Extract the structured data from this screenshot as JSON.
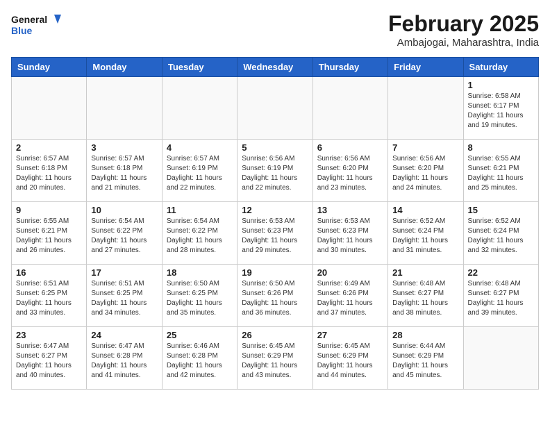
{
  "logo": {
    "line1": "General",
    "line2": "Blue"
  },
  "title": "February 2025",
  "subtitle": "Ambajogai, Maharashtra, India",
  "days_of_week": [
    "Sunday",
    "Monday",
    "Tuesday",
    "Wednesday",
    "Thursday",
    "Friday",
    "Saturday"
  ],
  "weeks": [
    [
      {
        "day": "",
        "info": ""
      },
      {
        "day": "",
        "info": ""
      },
      {
        "day": "",
        "info": ""
      },
      {
        "day": "",
        "info": ""
      },
      {
        "day": "",
        "info": ""
      },
      {
        "day": "",
        "info": ""
      },
      {
        "day": "1",
        "info": "Sunrise: 6:58 AM\nSunset: 6:17 PM\nDaylight: 11 hours\nand 19 minutes."
      }
    ],
    [
      {
        "day": "2",
        "info": "Sunrise: 6:57 AM\nSunset: 6:18 PM\nDaylight: 11 hours\nand 20 minutes."
      },
      {
        "day": "3",
        "info": "Sunrise: 6:57 AM\nSunset: 6:18 PM\nDaylight: 11 hours\nand 21 minutes."
      },
      {
        "day": "4",
        "info": "Sunrise: 6:57 AM\nSunset: 6:19 PM\nDaylight: 11 hours\nand 22 minutes."
      },
      {
        "day": "5",
        "info": "Sunrise: 6:56 AM\nSunset: 6:19 PM\nDaylight: 11 hours\nand 22 minutes."
      },
      {
        "day": "6",
        "info": "Sunrise: 6:56 AM\nSunset: 6:20 PM\nDaylight: 11 hours\nand 23 minutes."
      },
      {
        "day": "7",
        "info": "Sunrise: 6:56 AM\nSunset: 6:20 PM\nDaylight: 11 hours\nand 24 minutes."
      },
      {
        "day": "8",
        "info": "Sunrise: 6:55 AM\nSunset: 6:21 PM\nDaylight: 11 hours\nand 25 minutes."
      }
    ],
    [
      {
        "day": "9",
        "info": "Sunrise: 6:55 AM\nSunset: 6:21 PM\nDaylight: 11 hours\nand 26 minutes."
      },
      {
        "day": "10",
        "info": "Sunrise: 6:54 AM\nSunset: 6:22 PM\nDaylight: 11 hours\nand 27 minutes."
      },
      {
        "day": "11",
        "info": "Sunrise: 6:54 AM\nSunset: 6:22 PM\nDaylight: 11 hours\nand 28 minutes."
      },
      {
        "day": "12",
        "info": "Sunrise: 6:53 AM\nSunset: 6:23 PM\nDaylight: 11 hours\nand 29 minutes."
      },
      {
        "day": "13",
        "info": "Sunrise: 6:53 AM\nSunset: 6:23 PM\nDaylight: 11 hours\nand 30 minutes."
      },
      {
        "day": "14",
        "info": "Sunrise: 6:52 AM\nSunset: 6:24 PM\nDaylight: 11 hours\nand 31 minutes."
      },
      {
        "day": "15",
        "info": "Sunrise: 6:52 AM\nSunset: 6:24 PM\nDaylight: 11 hours\nand 32 minutes."
      }
    ],
    [
      {
        "day": "16",
        "info": "Sunrise: 6:51 AM\nSunset: 6:25 PM\nDaylight: 11 hours\nand 33 minutes."
      },
      {
        "day": "17",
        "info": "Sunrise: 6:51 AM\nSunset: 6:25 PM\nDaylight: 11 hours\nand 34 minutes."
      },
      {
        "day": "18",
        "info": "Sunrise: 6:50 AM\nSunset: 6:25 PM\nDaylight: 11 hours\nand 35 minutes."
      },
      {
        "day": "19",
        "info": "Sunrise: 6:50 AM\nSunset: 6:26 PM\nDaylight: 11 hours\nand 36 minutes."
      },
      {
        "day": "20",
        "info": "Sunrise: 6:49 AM\nSunset: 6:26 PM\nDaylight: 11 hours\nand 37 minutes."
      },
      {
        "day": "21",
        "info": "Sunrise: 6:48 AM\nSunset: 6:27 PM\nDaylight: 11 hours\nand 38 minutes."
      },
      {
        "day": "22",
        "info": "Sunrise: 6:48 AM\nSunset: 6:27 PM\nDaylight: 11 hours\nand 39 minutes."
      }
    ],
    [
      {
        "day": "23",
        "info": "Sunrise: 6:47 AM\nSunset: 6:27 PM\nDaylight: 11 hours\nand 40 minutes."
      },
      {
        "day": "24",
        "info": "Sunrise: 6:47 AM\nSunset: 6:28 PM\nDaylight: 11 hours\nand 41 minutes."
      },
      {
        "day": "25",
        "info": "Sunrise: 6:46 AM\nSunset: 6:28 PM\nDaylight: 11 hours\nand 42 minutes."
      },
      {
        "day": "26",
        "info": "Sunrise: 6:45 AM\nSunset: 6:29 PM\nDaylight: 11 hours\nand 43 minutes."
      },
      {
        "day": "27",
        "info": "Sunrise: 6:45 AM\nSunset: 6:29 PM\nDaylight: 11 hours\nand 44 minutes."
      },
      {
        "day": "28",
        "info": "Sunrise: 6:44 AM\nSunset: 6:29 PM\nDaylight: 11 hours\nand 45 minutes."
      },
      {
        "day": "",
        "info": ""
      }
    ]
  ]
}
